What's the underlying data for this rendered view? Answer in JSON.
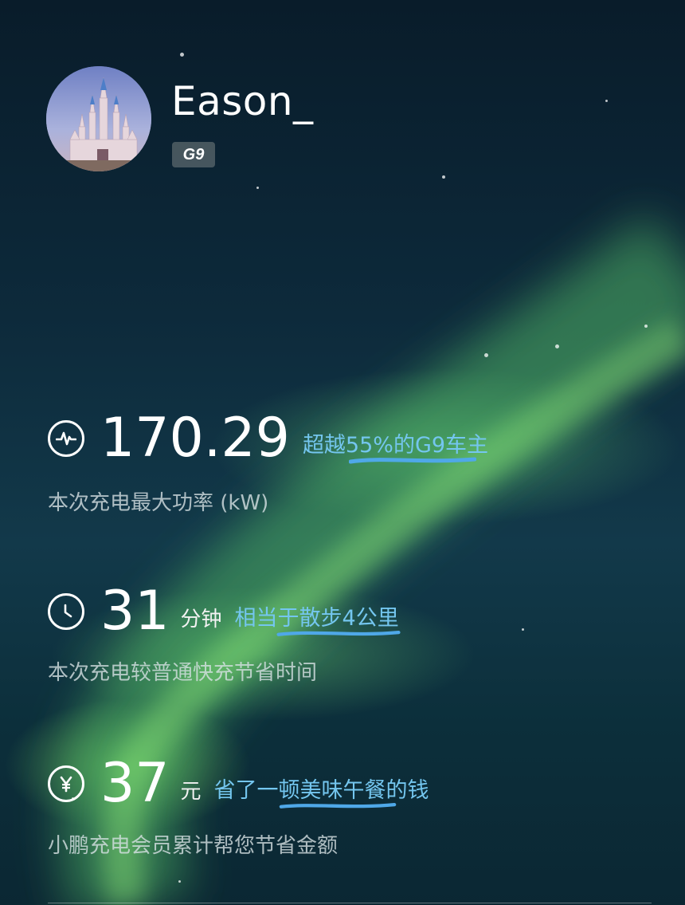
{
  "profile": {
    "username": "Eason_",
    "badge": "G9"
  },
  "metrics": [
    {
      "icon": "pulse-icon",
      "value": "170.29",
      "unit": "",
      "highlight": "超越55%的G9车主",
      "caption": "本次充电最大功率 (kW)"
    },
    {
      "icon": "clock-icon",
      "value": "31",
      "unit": "分钟",
      "highlight": "相当于散步4公里",
      "caption": "本次充电较普通快充节省时间"
    },
    {
      "icon": "yuan-icon",
      "value": "37",
      "unit": "元",
      "highlight": "省了一顿美味午餐的钱",
      "caption": "小鹏充电会员累计帮您节省金额"
    }
  ],
  "colors": {
    "highlight_text": "#74c6ef",
    "underline": "#4fa8e8",
    "background_top": "#091c2a",
    "aurora": "#5cbe6e"
  }
}
